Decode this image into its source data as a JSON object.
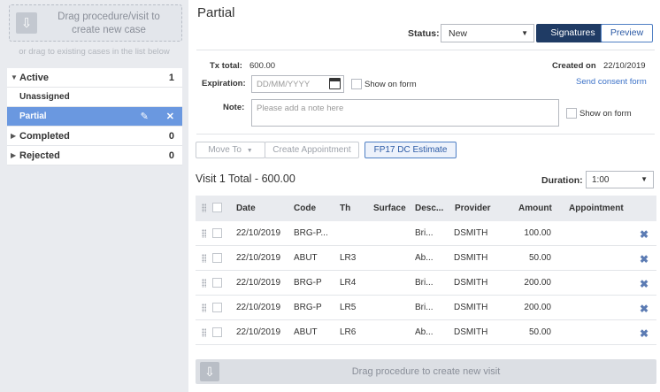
{
  "sidebar": {
    "dropzone": {
      "line1": "Drag procedure/visit to",
      "line2": "create new case",
      "icon": "download-arrow-icon"
    },
    "hint": "or drag to existing cases in the list below",
    "groups": [
      {
        "label": "Active",
        "count": "1",
        "expanded": true
      },
      {
        "label": "Unassigned"
      },
      {
        "label": "Partial",
        "selected": true
      },
      {
        "label": "Completed",
        "count": "0"
      },
      {
        "label": "Rejected",
        "count": "0"
      }
    ]
  },
  "header": {
    "title": "Partial",
    "status_label": "Status:",
    "status_value": "New",
    "signatures_label": "Signatures",
    "preview_label": "Preview"
  },
  "form": {
    "tx_total_label": "Tx total:",
    "tx_total_value": "600.00",
    "created_label": "Created on",
    "created_value": "22/10/2019",
    "expiration_label": "Expiration:",
    "expiration_placeholder": "DD/MM/YYYY",
    "show_on_form_label": "Show on form",
    "send_consent_label": "Send consent form",
    "note_label": "Note:",
    "note_placeholder": "Please add a note here"
  },
  "toolbar": {
    "move_to_label": "Move To",
    "create_appt_label": "Create Appointment",
    "fp17_label": "FP17 DC Estimate"
  },
  "visit": {
    "total_label": "Visit 1 Total - 600.00",
    "duration_label": "Duration:",
    "duration_value": "1:00"
  },
  "grid": {
    "columns": [
      "Date",
      "Code",
      "Th",
      "Surface",
      "Desc...",
      "Provider",
      "Amount",
      "Appointment"
    ],
    "rows": [
      {
        "date": "22/10/2019",
        "code": "BRG-P...",
        "th": "",
        "surface": "",
        "desc": "Bri...",
        "provider": "DSMITH",
        "amount": "100.00"
      },
      {
        "date": "22/10/2019",
        "code": "ABUT",
        "th": "LR3",
        "surface": "",
        "desc": "Ab...",
        "provider": "DSMITH",
        "amount": "50.00"
      },
      {
        "date": "22/10/2019",
        "code": "BRG-P",
        "th": "LR4",
        "surface": "",
        "desc": "Bri...",
        "provider": "DSMITH",
        "amount": "200.00"
      },
      {
        "date": "22/10/2019",
        "code": "BRG-P",
        "th": "LR5",
        "surface": "",
        "desc": "Bri...",
        "provider": "DSMITH",
        "amount": "200.00"
      },
      {
        "date": "22/10/2019",
        "code": "ABUT",
        "th": "LR6",
        "surface": "",
        "desc": "Ab...",
        "provider": "DSMITH",
        "amount": "50.00"
      }
    ]
  },
  "visit_drop": {
    "label": "Drag procedure to create new visit",
    "icon": "download-arrow-icon"
  },
  "colors": {
    "accent": "#1f3b64",
    "selected": "#6a98e0",
    "link": "#3c72c8",
    "sidebar_bg": "#e9ebef"
  }
}
